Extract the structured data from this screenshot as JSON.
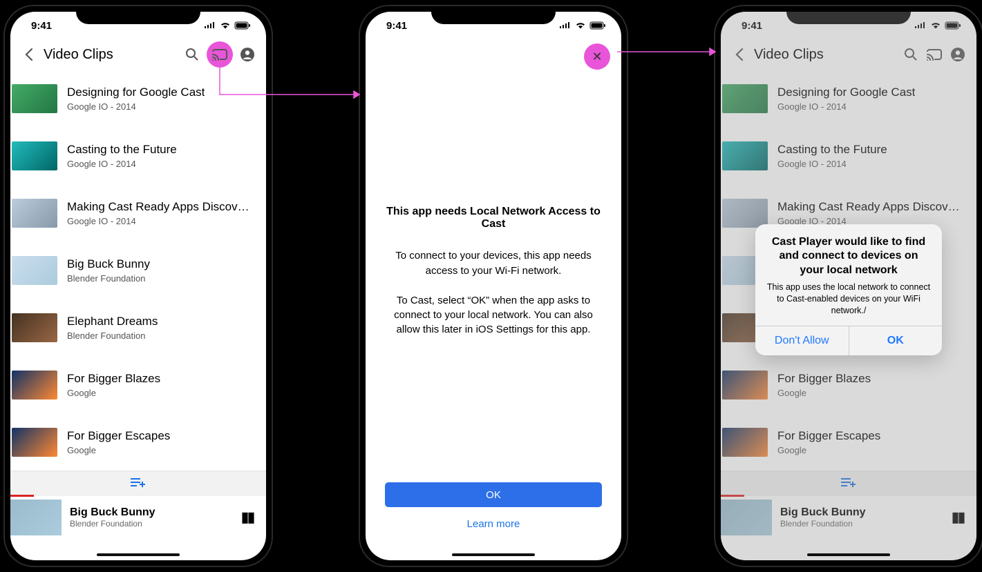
{
  "accent": "#e855d8",
  "primary_blue": "#2d6fe8",
  "ios_blue": "#1f79ff",
  "statusbar": {
    "time": "9:41"
  },
  "header": {
    "title": "Video Clips"
  },
  "videos": [
    {
      "title": "Designing for Google Cast",
      "subtitle": "Google IO - 2014"
    },
    {
      "title": "Casting to the Future",
      "subtitle": "Google IO - 2014"
    },
    {
      "title": "Making Cast Ready Apps Discover...",
      "subtitle": "Google IO - 2014"
    },
    {
      "title": "Big Buck Bunny",
      "subtitle": "Blender Foundation"
    },
    {
      "title": "Elephant Dreams",
      "subtitle": "Blender Foundation"
    },
    {
      "title": "For Bigger Blazes",
      "subtitle": "Google"
    },
    {
      "title": "For Bigger Escapes",
      "subtitle": "Google"
    }
  ],
  "mini_player": {
    "title": "Big Buck Bunny",
    "subtitle": "Blender Foundation"
  },
  "interstitial": {
    "title": "This app needs Local Network Access to Cast",
    "p1": "To connect to your devices, this app needs access to your Wi-Fi network.",
    "p2": "To Cast, select “OK” when the app asks to connect to your local network. You can also allow this later in iOS Settings for this app.",
    "ok": "OK",
    "learn": "Learn more"
  },
  "ios_alert": {
    "title": "Cast Player would like to find and connect to devices on your local network",
    "body": "This app uses the local network to connect to Cast-enabled devices on your WiFi network./",
    "dont_allow": "Don't Allow",
    "ok": "OK"
  }
}
